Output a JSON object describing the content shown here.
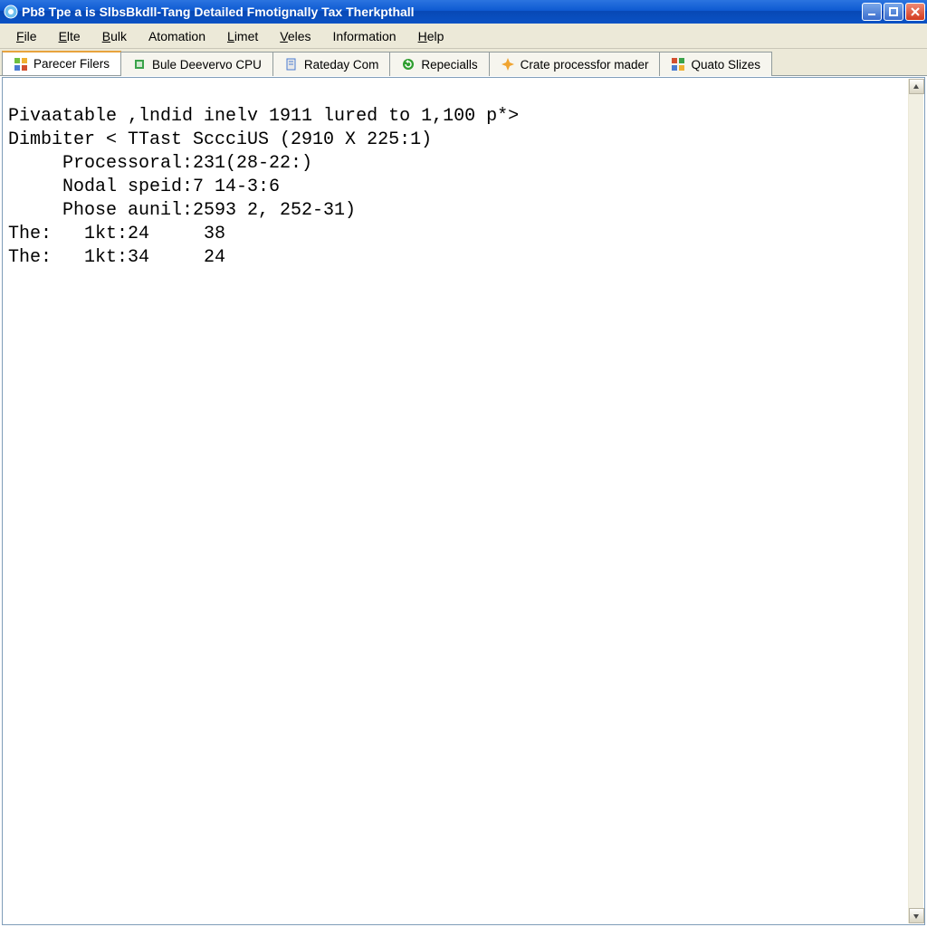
{
  "window": {
    "title": "Pb8 Tpe a is SlbsBkdll-Tang Detailed Fmotignally Tax Therkpthall"
  },
  "menu": {
    "items": [
      {
        "label": "File",
        "accel": "F"
      },
      {
        "label": "Elte",
        "accel": "E"
      },
      {
        "label": "Bulk",
        "accel": "B"
      },
      {
        "label": "Atomation",
        "accel": ""
      },
      {
        "label": "Limet",
        "accel": "L"
      },
      {
        "label": "Veles",
        "accel": "V"
      },
      {
        "label": "Information",
        "accel": ""
      },
      {
        "label": "Help",
        "accel": "H"
      }
    ]
  },
  "tabs": [
    {
      "label": "Parecer Filers",
      "active": true,
      "icon_color": "#6fbf3e"
    },
    {
      "label": "Bule Deevervo CPU",
      "active": false,
      "icon_color": "#3aa34a"
    },
    {
      "label": "Rateday Com",
      "active": false,
      "icon_color": "#4a7bd1"
    },
    {
      "label": "Repecialls",
      "active": false,
      "icon_color": "#2f9e2f"
    },
    {
      "label": "Crate processfor mader",
      "active": false,
      "icon_color": "#f0a430"
    },
    {
      "label": "Quato Slizes",
      "active": false,
      "icon_color": "#d34f2e"
    }
  ],
  "console": {
    "lines": [
      "Pivaatable ,lndid inelv 1911 lured to 1,100 p*>",
      "Dimbiter < TTast ScсciUS (2910 X 225:1)",
      "     Processoral:231(28-22:)",
      "     Nodal speid:7 14-3:6",
      "     Phose aunil:2593 2, 252-31)",
      "The:   1kt:24     38",
      "The:   1kt:34     24"
    ]
  }
}
